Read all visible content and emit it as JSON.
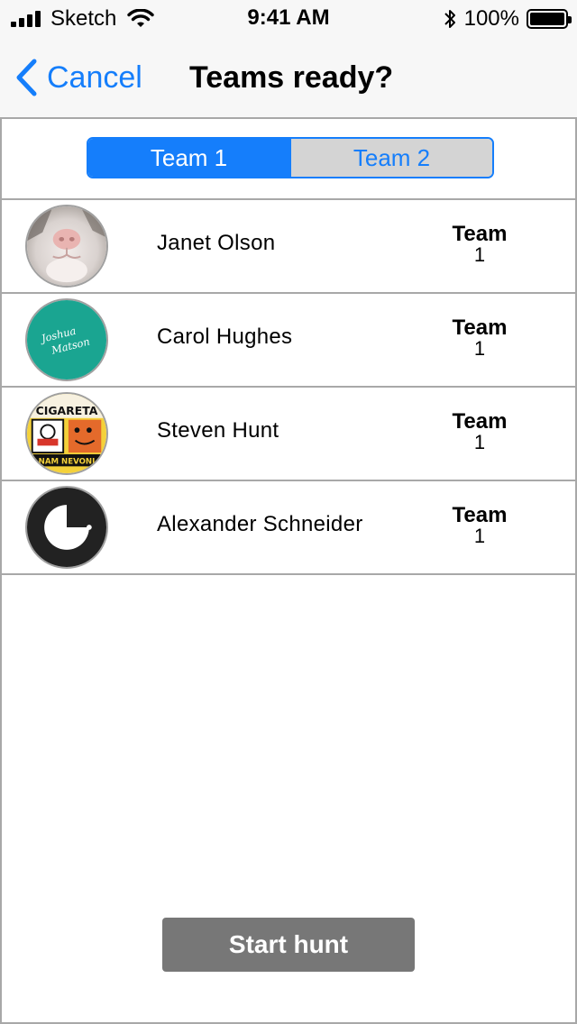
{
  "status_bar": {
    "carrier": "Sketch",
    "time": "9:41 AM",
    "battery": "100%"
  },
  "nav": {
    "back_label": "Cancel",
    "title": "Teams ready?"
  },
  "segment": {
    "options": [
      "Team 1",
      "Team 2"
    ],
    "selected": "Team 1"
  },
  "players": [
    {
      "name": "Janet Olson",
      "team_label": "Team",
      "team_number": "1",
      "avatar": "cat-nose-photo"
    },
    {
      "name": "Carol Hughes",
      "team_label": "Team",
      "team_number": "1",
      "avatar": "teal-signature-logo"
    },
    {
      "name": "Steven Hunt",
      "team_label": "Team",
      "team_number": "1",
      "avatar": "cigarette-poster-art"
    },
    {
      "name": "Alexander Schneider",
      "team_label": "Team",
      "team_number": "1",
      "avatar": "black-pie-logo"
    }
  ],
  "actions": {
    "start_label": "Start hunt"
  },
  "colors": {
    "accent": "#157efb",
    "button_gray": "#777777",
    "segment_inactive": "#d4d4d4",
    "avatar_teal": "#1aa591"
  },
  "avatar_texts": {
    "signature": "Joshua Matson",
    "poster_top": "CIGARETA",
    "poster_bottom": "NAM NEVONI"
  }
}
